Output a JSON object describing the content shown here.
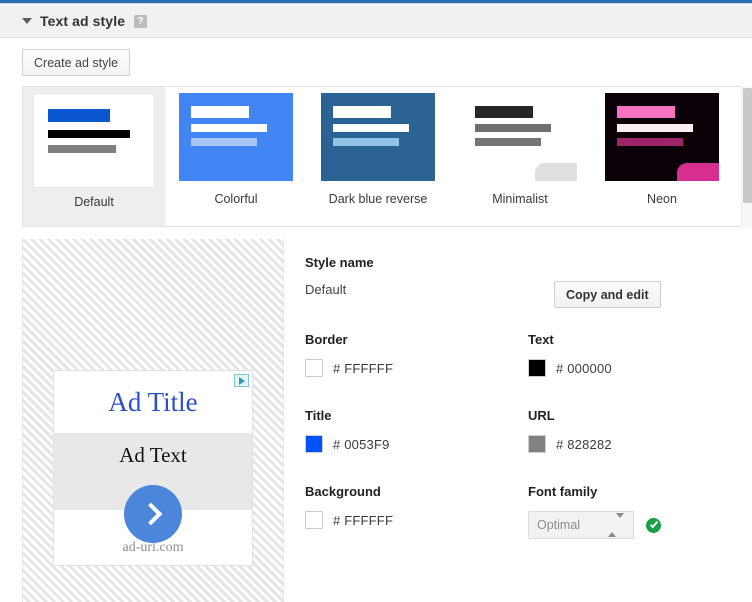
{
  "header": {
    "title": "Text ad style",
    "help_icon": "help-icon",
    "collapse_icon": "triangle-down-icon"
  },
  "toolbar": {
    "create_label": "Create ad style"
  },
  "styles": [
    {
      "name": "Default",
      "selected": true,
      "card_bg": "#FFFFFF",
      "bars": [
        "#0B57D0",
        "#000000",
        "#808080"
      ],
      "fold": false
    },
    {
      "name": "Colorful",
      "selected": false,
      "card_bg": "#4285F4",
      "bars": [
        "#FFFFFF",
        "#FFFFFF",
        "#A8C7F5"
      ],
      "fold": false
    },
    {
      "name": "Dark blue reverse",
      "selected": false,
      "card_bg": "#2C6395",
      "bars": [
        "#FFFFFF",
        "#FFFFFF",
        "#8FC4E8"
      ],
      "fold": false
    },
    {
      "name": "Minimalist",
      "selected": false,
      "card_bg": "#FFFFFF",
      "bars": [
        "#262626",
        "#6E6E6E",
        "#757575"
      ],
      "fold": true,
      "fold_color": "#E0E0E0"
    },
    {
      "name": "Neon",
      "selected": false,
      "card_bg": "#0B0008",
      "bars": [
        "#F472C0",
        "#F5F0F0",
        "#9E2468"
      ],
      "fold": true,
      "fold_color": "#D62F8F"
    }
  ],
  "preview": {
    "ad_title": "Ad Title",
    "ad_text": "Ad Text",
    "ad_url": "ad-url.com",
    "adchoices_icon": "adchoices-icon",
    "cta_icon": "chevron-right-icon"
  },
  "form": {
    "style_name_label": "Style name",
    "style_name_value": "Default",
    "copy_edit_label": "Copy and edit",
    "border_label": "Border",
    "border_value": "# FFFFFF",
    "border_color": "#FFFFFF",
    "text_label": "Text",
    "text_value": "# 000000",
    "text_color": "#000000",
    "title_label": "Title",
    "title_value": "# 0053F9",
    "title_color": "#0053F9",
    "url_label": "URL",
    "url_value": "# 828282",
    "url_color": "#828282",
    "background_label": "Background",
    "background_value": "# FFFFFF",
    "background_color": "#FFFFFF",
    "font_family_label": "Font family",
    "font_family_value": "Optimal",
    "valid_icon": "check-circle-icon"
  },
  "theme": {
    "accent_blue": "#2B6CB5",
    "header_bg": "#F1F1F1",
    "selected_thumb_bg": "#EEEEEE"
  }
}
